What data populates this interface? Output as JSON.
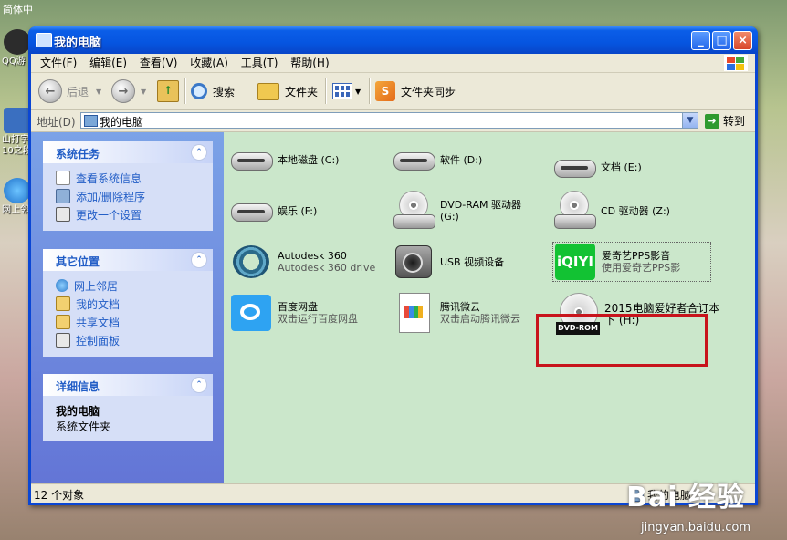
{
  "desktop": {
    "top_label": "简体中",
    "icons": [
      {
        "label": "QQ游"
      },
      {
        "label": "山打字 10之段"
      },
      {
        "label": "网上邻"
      }
    ]
  },
  "window": {
    "title": "我的电脑",
    "buttons": {
      "minimize": "_",
      "maximize": "□",
      "close": "×"
    }
  },
  "menubar": {
    "items": [
      "文件(F)",
      "编辑(E)",
      "查看(V)",
      "收藏(A)",
      "工具(T)",
      "帮助(H)"
    ]
  },
  "toolbar": {
    "back": "后退",
    "forward": "",
    "search": "搜索",
    "folders": "文件夹",
    "sync": "文件夹同步"
  },
  "address": {
    "label": "地址(D)",
    "value": "我的电脑",
    "go": "转到"
  },
  "left_panels": {
    "system_tasks": {
      "title": "系统任务",
      "items": [
        "查看系统信息",
        "添加/删除程序",
        "更改一个设置"
      ]
    },
    "other_places": {
      "title": "其它位置",
      "items": [
        "网上邻居",
        "我的文档",
        "共享文档",
        "控制面板"
      ]
    },
    "details": {
      "title": "详细信息",
      "name": "我的电脑",
      "desc": "系统文件夹"
    }
  },
  "items": [
    {
      "name": "本地磁盘 (C:)",
      "sub": ""
    },
    {
      "name": "软件 (D:)",
      "sub": ""
    },
    {
      "name": "文档 (E:)",
      "sub": ""
    },
    {
      "name": "娱乐 (F:)",
      "sub": ""
    },
    {
      "name": "DVD-RAM 驱动器 (G:)",
      "sub": ""
    },
    {
      "name": "CD 驱动器 (Z:)",
      "sub": ""
    },
    {
      "name": "Autodesk 360",
      "sub": "Autodesk 360 drive"
    },
    {
      "name": "USB 视频设备",
      "sub": ""
    },
    {
      "name": "爱奇艺PPS影音",
      "sub": "使用爱奇艺PPS影"
    },
    {
      "name": "百度网盘",
      "sub": "双击运行百度网盘"
    },
    {
      "name": "腾讯微云",
      "sub": "双击启动腾讯微云"
    },
    {
      "name": "2015电脑爱好者合订本下 (H:)",
      "sub": ""
    }
  ],
  "statusbar": {
    "count": "12 个对象",
    "right": "我的电脑"
  },
  "watermark": {
    "logo": "Bai 经验",
    "url": "jingyan.baidu.com"
  },
  "colors": {
    "titlebar": "#0655e0",
    "content_bg": "#cbe7cb",
    "task_pane": "#6f8ee0",
    "highlight_box": "#c8141c",
    "link_blue": "#215dc6"
  }
}
